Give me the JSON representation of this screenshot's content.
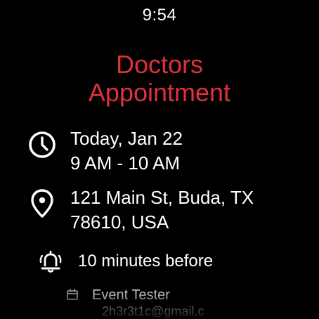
{
  "status_bar": {
    "time": "9:54"
  },
  "event": {
    "title_line1": "Doctors",
    "title_line2": "Appointment",
    "title_color": "#e0303c"
  },
  "details": {
    "date": "Today, Jan 22",
    "time_range": "9 AM - 10 AM",
    "location_line1": "121 Main St, Buda, TX",
    "location_line2": "78610, USA",
    "reminder": "10 minutes before",
    "account_name": "Event Tester",
    "account_email": "2h3r3t1c@gmail.c"
  },
  "icons": {
    "time": "clock-icon",
    "location": "location-pin-icon",
    "reminder": "bell-icon",
    "account": "calendar-account-icon"
  }
}
